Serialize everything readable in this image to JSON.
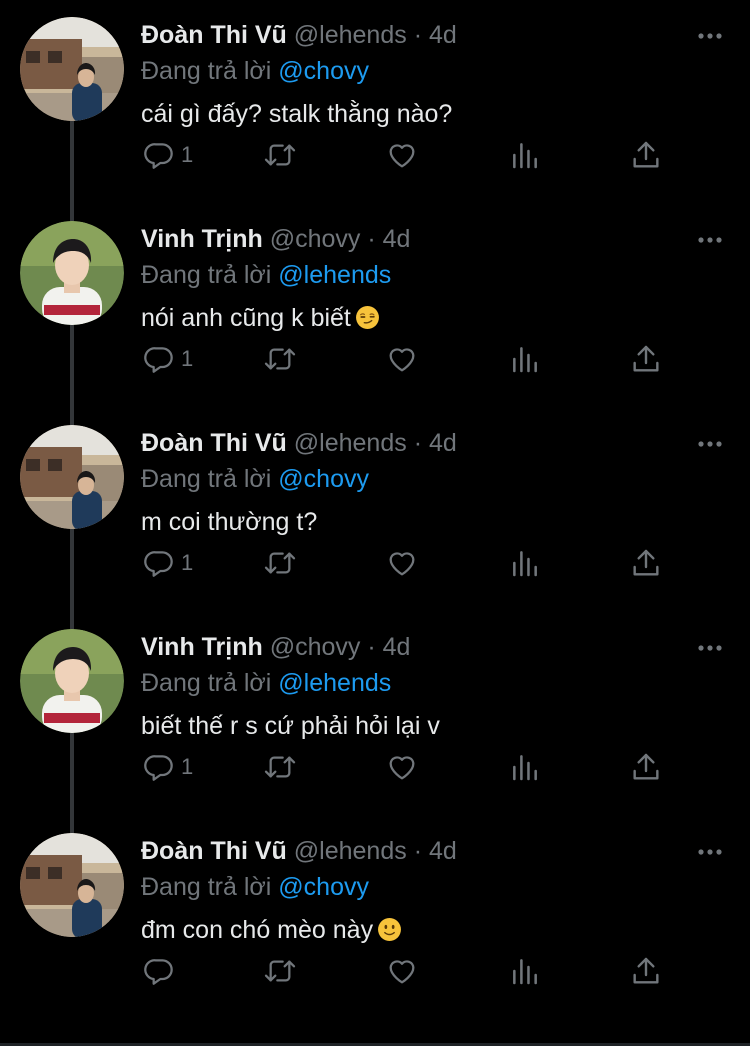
{
  "tweets": [
    {
      "name": "Đoàn Thi Vũ",
      "handle": "@lehends",
      "dot": "·",
      "time": "4d",
      "reply_prefix": "Đang trả lời",
      "reply_to": "@chovy",
      "text": "cái gì đấy? stalk thằng nào?",
      "emoji": "",
      "reply_count": "1",
      "avatar": "street-photo"
    },
    {
      "name": "Vinh Trịnh",
      "handle": "@chovy",
      "dot": "·",
      "time": "4d",
      "reply_prefix": "Đang trả lời",
      "reply_to": "@lehends",
      "text": "nói anh cũng k biết",
      "emoji": "smirking-face",
      "reply_count": "1",
      "avatar": "jersey-photo"
    },
    {
      "name": "Đoàn Thi Vũ",
      "handle": "@lehends",
      "dot": "·",
      "time": "4d",
      "reply_prefix": "Đang trả lời",
      "reply_to": "@chovy",
      "text": "m coi thường t?",
      "emoji": "",
      "reply_count": "1",
      "avatar": "street-photo"
    },
    {
      "name": "Vinh Trịnh",
      "handle": "@chovy",
      "dot": "·",
      "time": "4d",
      "reply_prefix": "Đang trả lời",
      "reply_to": "@lehends",
      "text": "biết thế r s cứ phải hỏi lại v",
      "emoji": "",
      "reply_count": "1",
      "avatar": "jersey-photo"
    },
    {
      "name": "Đoàn Thi Vũ",
      "handle": "@lehends",
      "dot": "·",
      "time": "4d",
      "reply_prefix": "Đang trả lời",
      "reply_to": "@chovy",
      "text": "đm con chó mèo này",
      "emoji": "slightly-smiling-face",
      "reply_count": "",
      "avatar": "street-photo"
    }
  ],
  "icons": {
    "reply": "reply-icon",
    "retweet": "retweet-icon",
    "like": "heart-icon",
    "views": "analytics-icon",
    "share": "share-icon",
    "more": "more-icon"
  },
  "colors": {
    "background": "#000000",
    "text": "#e7e9ea",
    "muted": "#71767b",
    "mention": "#1d9bf0",
    "thread_line": "#333639"
  }
}
